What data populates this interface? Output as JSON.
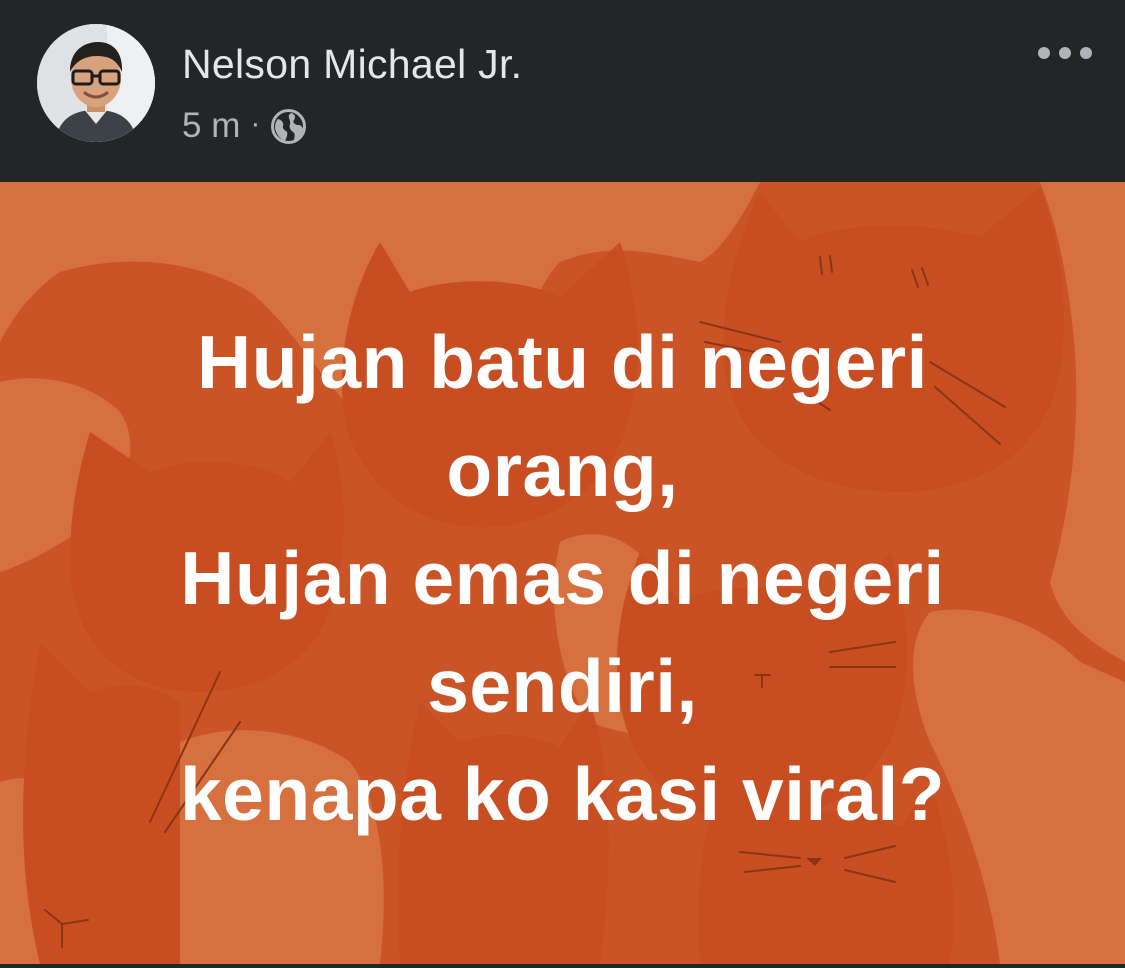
{
  "post": {
    "author": "Nelson Michael Jr.",
    "timestamp": "5 m",
    "separator": "·",
    "privacy_icon": "globe-icon",
    "more_icon": "more-options-icon",
    "avatar_icon": "profile-photo"
  },
  "card": {
    "lines": [
      "Hujan batu di negeri",
      "orang,",
      "Hujan emas di negeri",
      "sendiri,",
      "kenapa ko kasi viral?"
    ],
    "background_color": "#cb5427",
    "pattern_color": "#d7703f",
    "text_color": "#ffffff"
  },
  "theme": {
    "header_bg": "#242526",
    "name_color": "#e4e6eb",
    "meta_color": "#b0b3b8"
  }
}
